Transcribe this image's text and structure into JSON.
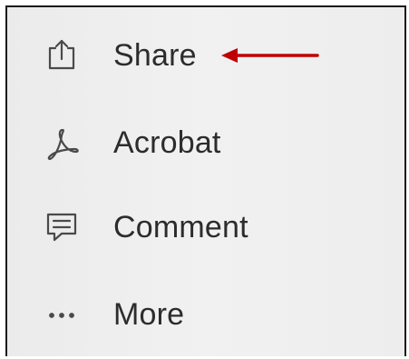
{
  "menu": {
    "items": [
      {
        "label": "Share",
        "icon": "share-icon"
      },
      {
        "label": "Acrobat",
        "icon": "acrobat-icon"
      },
      {
        "label": "Comment",
        "icon": "comment-icon"
      },
      {
        "label": "More",
        "icon": "more-icon"
      }
    ]
  },
  "annotation": {
    "arrow_color": "#c00000",
    "points_to": "Share"
  },
  "colors": {
    "panel_background": "#eeeeee",
    "text": "#2c2c2c",
    "icon": "#4a4a4a",
    "border": "#1a1a1a"
  }
}
